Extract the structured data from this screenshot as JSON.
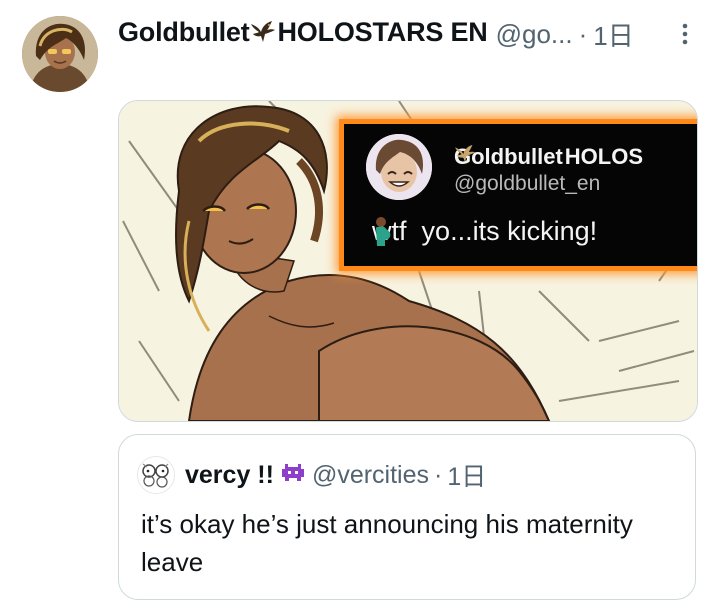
{
  "post": {
    "author": {
      "display_name": "Goldbullet",
      "display_name_suffix": "HOLOSTARS EN",
      "handle": "@go...",
      "separator": "·",
      "time": "1日",
      "avatar_icon": "avatar-image",
      "badge_icon": "eagle-icon"
    },
    "more_icon": "more-icon",
    "media": {
      "overlay": {
        "name": "Goldbullet",
        "name_suffix": "HOLOS",
        "handle": "@goldbullet_en",
        "text_before": "wtf",
        "text_after": "yo...its kicking!",
        "emoji_icon": "pregnant-person-emoji",
        "border_color": "#ff8a1a"
      }
    }
  },
  "quote": {
    "author": {
      "display_name": "vercy !!",
      "handle": "@vercities",
      "separator": "·",
      "time": "1日",
      "badge_icon": "alien-monster-emoji"
    },
    "text": "it’s okay he’s just announcing his maternity leave"
  },
  "colors": {
    "primary_text": "#0f1419",
    "secondary_text": "#536471",
    "border": "#cfd9de"
  }
}
